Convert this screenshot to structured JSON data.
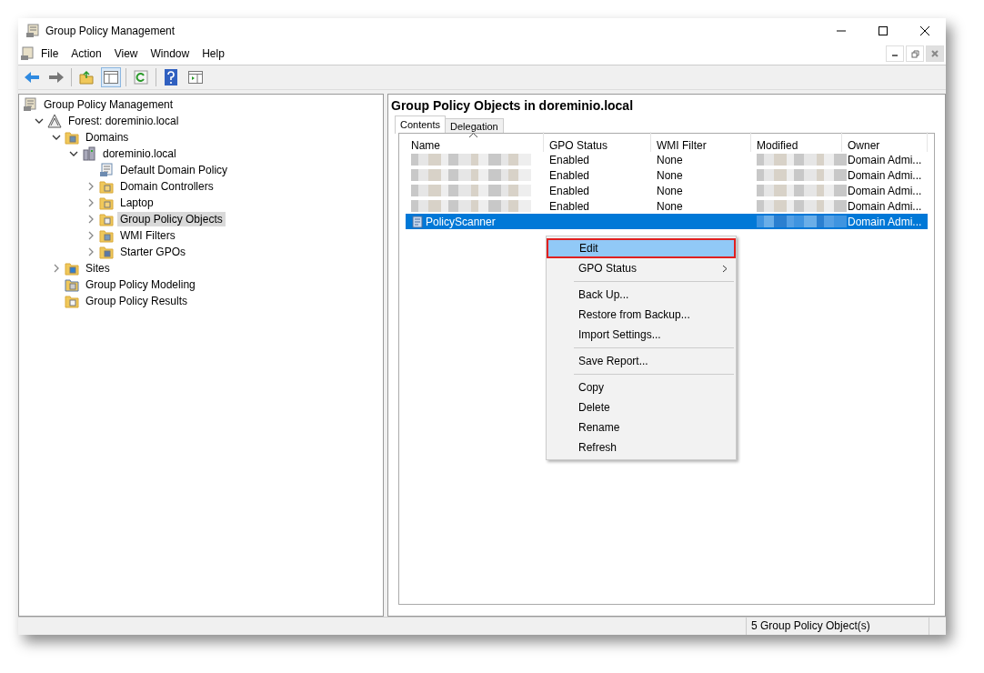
{
  "window": {
    "title": "Group Policy Management"
  },
  "menu_bar": [
    "File",
    "Action",
    "View",
    "Window",
    "Help"
  ],
  "tree": [
    {
      "label": "Group Policy Management",
      "kind": "console",
      "selected": false,
      "children": [
        {
          "label": "Forest: doreminio.local",
          "kind": "forest",
          "expanded": true,
          "selected": false,
          "children": [
            {
              "label": "Domains",
              "kind": "domains",
              "expanded": true,
              "selected": false,
              "children": [
                {
                  "label": "doreminio.local",
                  "kind": "domain",
                  "expanded": true,
                  "selected": false,
                  "children": [
                    {
                      "label": "Default Domain Policy",
                      "kind": "gpo-link",
                      "selected": false
                    },
                    {
                      "label": "Domain Controllers",
                      "kind": "ou",
                      "expanded": false,
                      "selected": false
                    },
                    {
                      "label": "Laptop",
                      "kind": "ou",
                      "expanded": false,
                      "selected": false
                    },
                    {
                      "label": "Group Policy Objects",
                      "kind": "gpo-folder",
                      "expanded": false,
                      "selected": true
                    },
                    {
                      "label": "WMI Filters",
                      "kind": "wmi",
                      "expanded": false,
                      "selected": false
                    },
                    {
                      "label": "Starter GPOs",
                      "kind": "starter",
                      "expanded": false,
                      "selected": false
                    }
                  ]
                }
              ]
            },
            {
              "label": "Sites",
              "kind": "sites",
              "expanded": false,
              "selected": false
            },
            {
              "label": "Group Policy Modeling",
              "kind": "modeling",
              "selected": false
            },
            {
              "label": "Group Policy Results",
              "kind": "results",
              "selected": false
            }
          ]
        }
      ]
    }
  ],
  "details": {
    "title": "Group Policy Objects in doreminio.local",
    "tabs": [
      {
        "label": "Contents",
        "selected": true
      },
      {
        "label": "Delegation",
        "selected": false
      }
    ],
    "columns": [
      {
        "label": "Name",
        "sorted": true
      },
      {
        "label": "GPO Status",
        "sorted": false
      },
      {
        "label": "WMI Filter",
        "sorted": false
      },
      {
        "label": "Modified",
        "sorted": false
      },
      {
        "label": "Owner",
        "sorted": false
      }
    ],
    "rows": [
      {
        "name_blurred": true,
        "selected": false,
        "gpo_status": "Enabled",
        "wmi_filter": "None",
        "owner": "Domain Admi..."
      },
      {
        "name_blurred": true,
        "selected": false,
        "gpo_status": "Enabled",
        "wmi_filter": "None",
        "owner": "Domain Admi..."
      },
      {
        "name_blurred": true,
        "selected": false,
        "gpo_status": "Enabled",
        "wmi_filter": "None",
        "owner": "Domain Admi..."
      },
      {
        "name_blurred": true,
        "selected": false,
        "gpo_status": "Enabled",
        "wmi_filter": "None",
        "owner": "Domain Admi..."
      },
      {
        "name": "PolicyScanner",
        "name_blurred": false,
        "selected": true,
        "owner": "Domain Admi..."
      }
    ]
  },
  "context_menu": {
    "groups": [
      [
        {
          "label": "Edit",
          "selected": true,
          "annotated": true,
          "submenu": false
        },
        {
          "label": "GPO Status",
          "selected": false,
          "annotated": false,
          "submenu": true
        }
      ],
      [
        {
          "label": "Back Up...",
          "selected": false,
          "annotated": false,
          "submenu": false
        },
        {
          "label": "Restore from Backup...",
          "selected": false,
          "annotated": false,
          "submenu": false
        },
        {
          "label": "Import Settings...",
          "selected": false,
          "annotated": false,
          "submenu": false
        }
      ],
      [
        {
          "label": "Save Report...",
          "selected": false,
          "annotated": false,
          "submenu": false
        }
      ],
      [
        {
          "label": "Copy",
          "selected": false,
          "annotated": false,
          "submenu": false
        },
        {
          "label": "Delete",
          "selected": false,
          "annotated": false,
          "submenu": false
        },
        {
          "label": "Rename",
          "selected": false,
          "annotated": false,
          "submenu": false
        },
        {
          "label": "Refresh",
          "selected": false,
          "annotated": false,
          "submenu": false
        }
      ]
    ]
  },
  "status_bar": {
    "text": "5 Group Policy Object(s)"
  }
}
